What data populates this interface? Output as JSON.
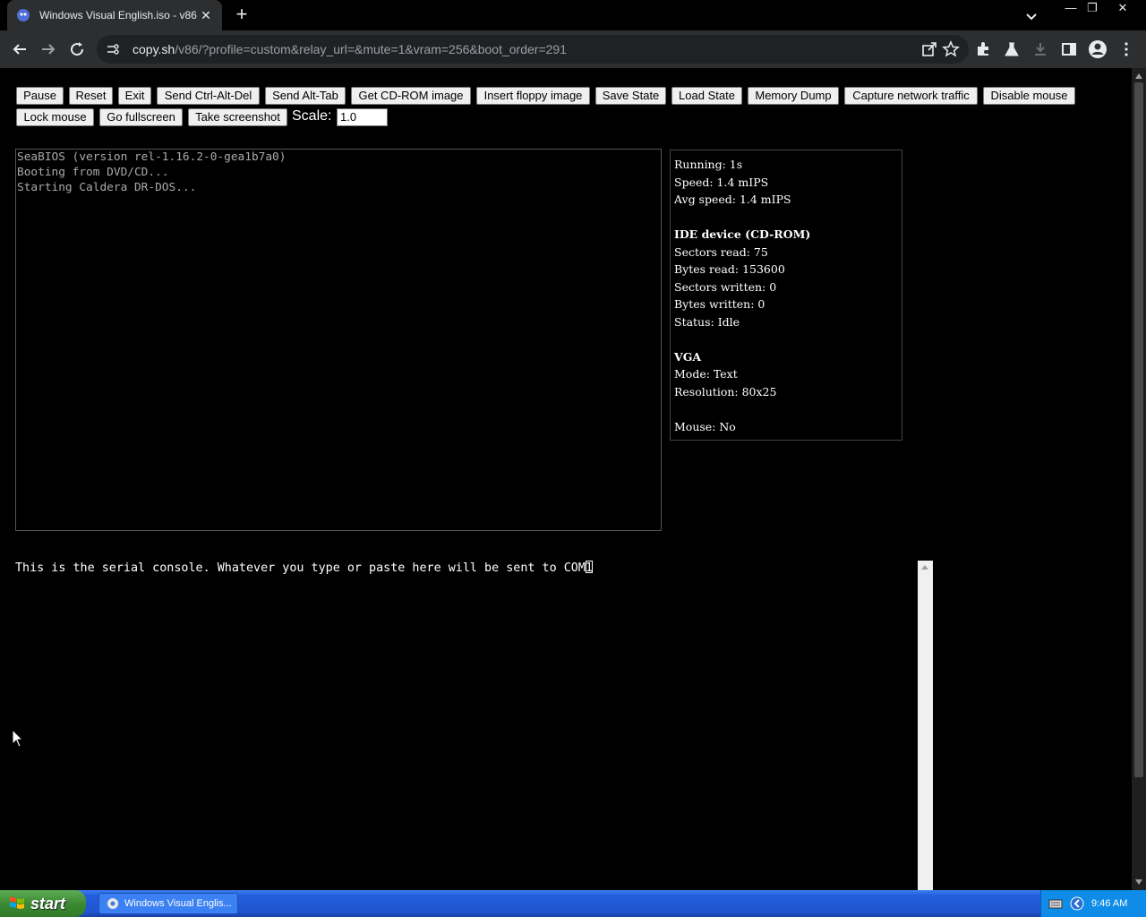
{
  "browser": {
    "tab_title": "Windows Visual English.iso - v86",
    "tab_close": "✕",
    "new_tab": "+",
    "url_host": "copy.sh",
    "url_rest": "/v86/?profile=custom&relay_url=&mute=1&vram=256&boot_order=291",
    "window_controls": {
      "minimize": "—",
      "restore": "❐",
      "close": "✕"
    }
  },
  "controls": {
    "buttons_row1": [
      "Pause",
      "Reset",
      "Exit",
      "Send Ctrl-Alt-Del",
      "Send Alt-Tab",
      "Get CD-ROM image",
      "Insert floppy image",
      "Save State",
      "Load State",
      "Memory Dump",
      "Capture network traffic",
      "Disable mouse"
    ],
    "buttons_row2": [
      "Lock mouse",
      "Go fullscreen",
      "Take screenshot"
    ],
    "scale_label": "Scale:",
    "scale_value": "1.0"
  },
  "screen": {
    "lines": [
      "SeaBIOS (version rel-1.16.2-0-gea1b7a0)",
      "Booting from DVD/CD...",
      "Starting Caldera DR-DOS..."
    ]
  },
  "info": {
    "running": "Running: 1s",
    "speed": "Speed: 1.4 mIPS",
    "avg_speed": "Avg speed: 1.4 mIPS",
    "ide_title": "IDE device (CD-ROM)",
    "sectors_read": "Sectors read: 75",
    "bytes_read": "Bytes read: 153600",
    "sectors_written": "Sectors written: 0",
    "bytes_written": "Bytes written: 0",
    "status": "Status: Idle",
    "vga_title": "VGA",
    "mode": "Mode: Text",
    "resolution": "Resolution: 80x25",
    "mouse": "Mouse: No"
  },
  "serial": {
    "text": "This is the serial console. Whatever you type or paste here will be sent to COM1"
  },
  "taskbar": {
    "start_label": "start",
    "task_label": "Windows Visual Englis...",
    "clock": "9:46 AM"
  }
}
